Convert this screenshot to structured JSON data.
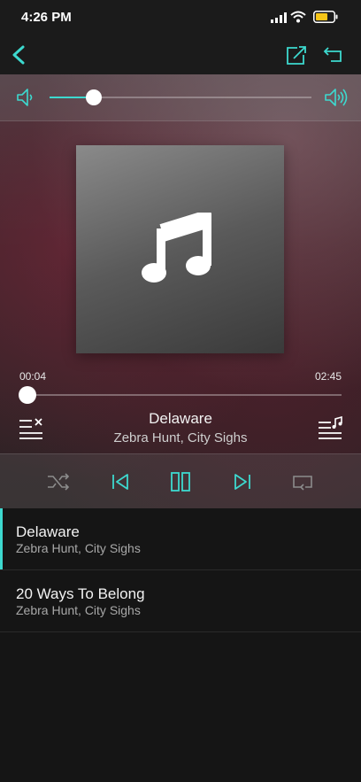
{
  "status_bar": {
    "time": "4:26 PM"
  },
  "colors": {
    "accent": "#3dd9cf",
    "background": "#151515",
    "battery": "#f5c518"
  },
  "icons": {
    "back": "chevron-left-icon",
    "share": "share-icon",
    "undo": "undo-icon",
    "volume_low": "volume-low-icon",
    "volume_high": "volume-high-icon",
    "album": "music-note-icon",
    "clear_queue": "clear-queue-icon",
    "queue": "queue-icon",
    "shuffle": "shuffle-icon",
    "previous": "previous-icon",
    "pause": "pause-icon",
    "next": "next-icon",
    "repeat": "repeat-icon"
  },
  "volume": {
    "level": 0.17
  },
  "player": {
    "current_time": "00:04",
    "total_time": "02:45",
    "progress": 0.024,
    "title": "Delaware",
    "artist": "Zebra Hunt, City Sighs"
  },
  "playlist": [
    {
      "title": "Delaware",
      "artist": "Zebra Hunt, City Sighs",
      "active": true
    },
    {
      "title": "20 Ways To Belong",
      "artist": "Zebra Hunt, City Sighs",
      "active": false
    }
  ]
}
